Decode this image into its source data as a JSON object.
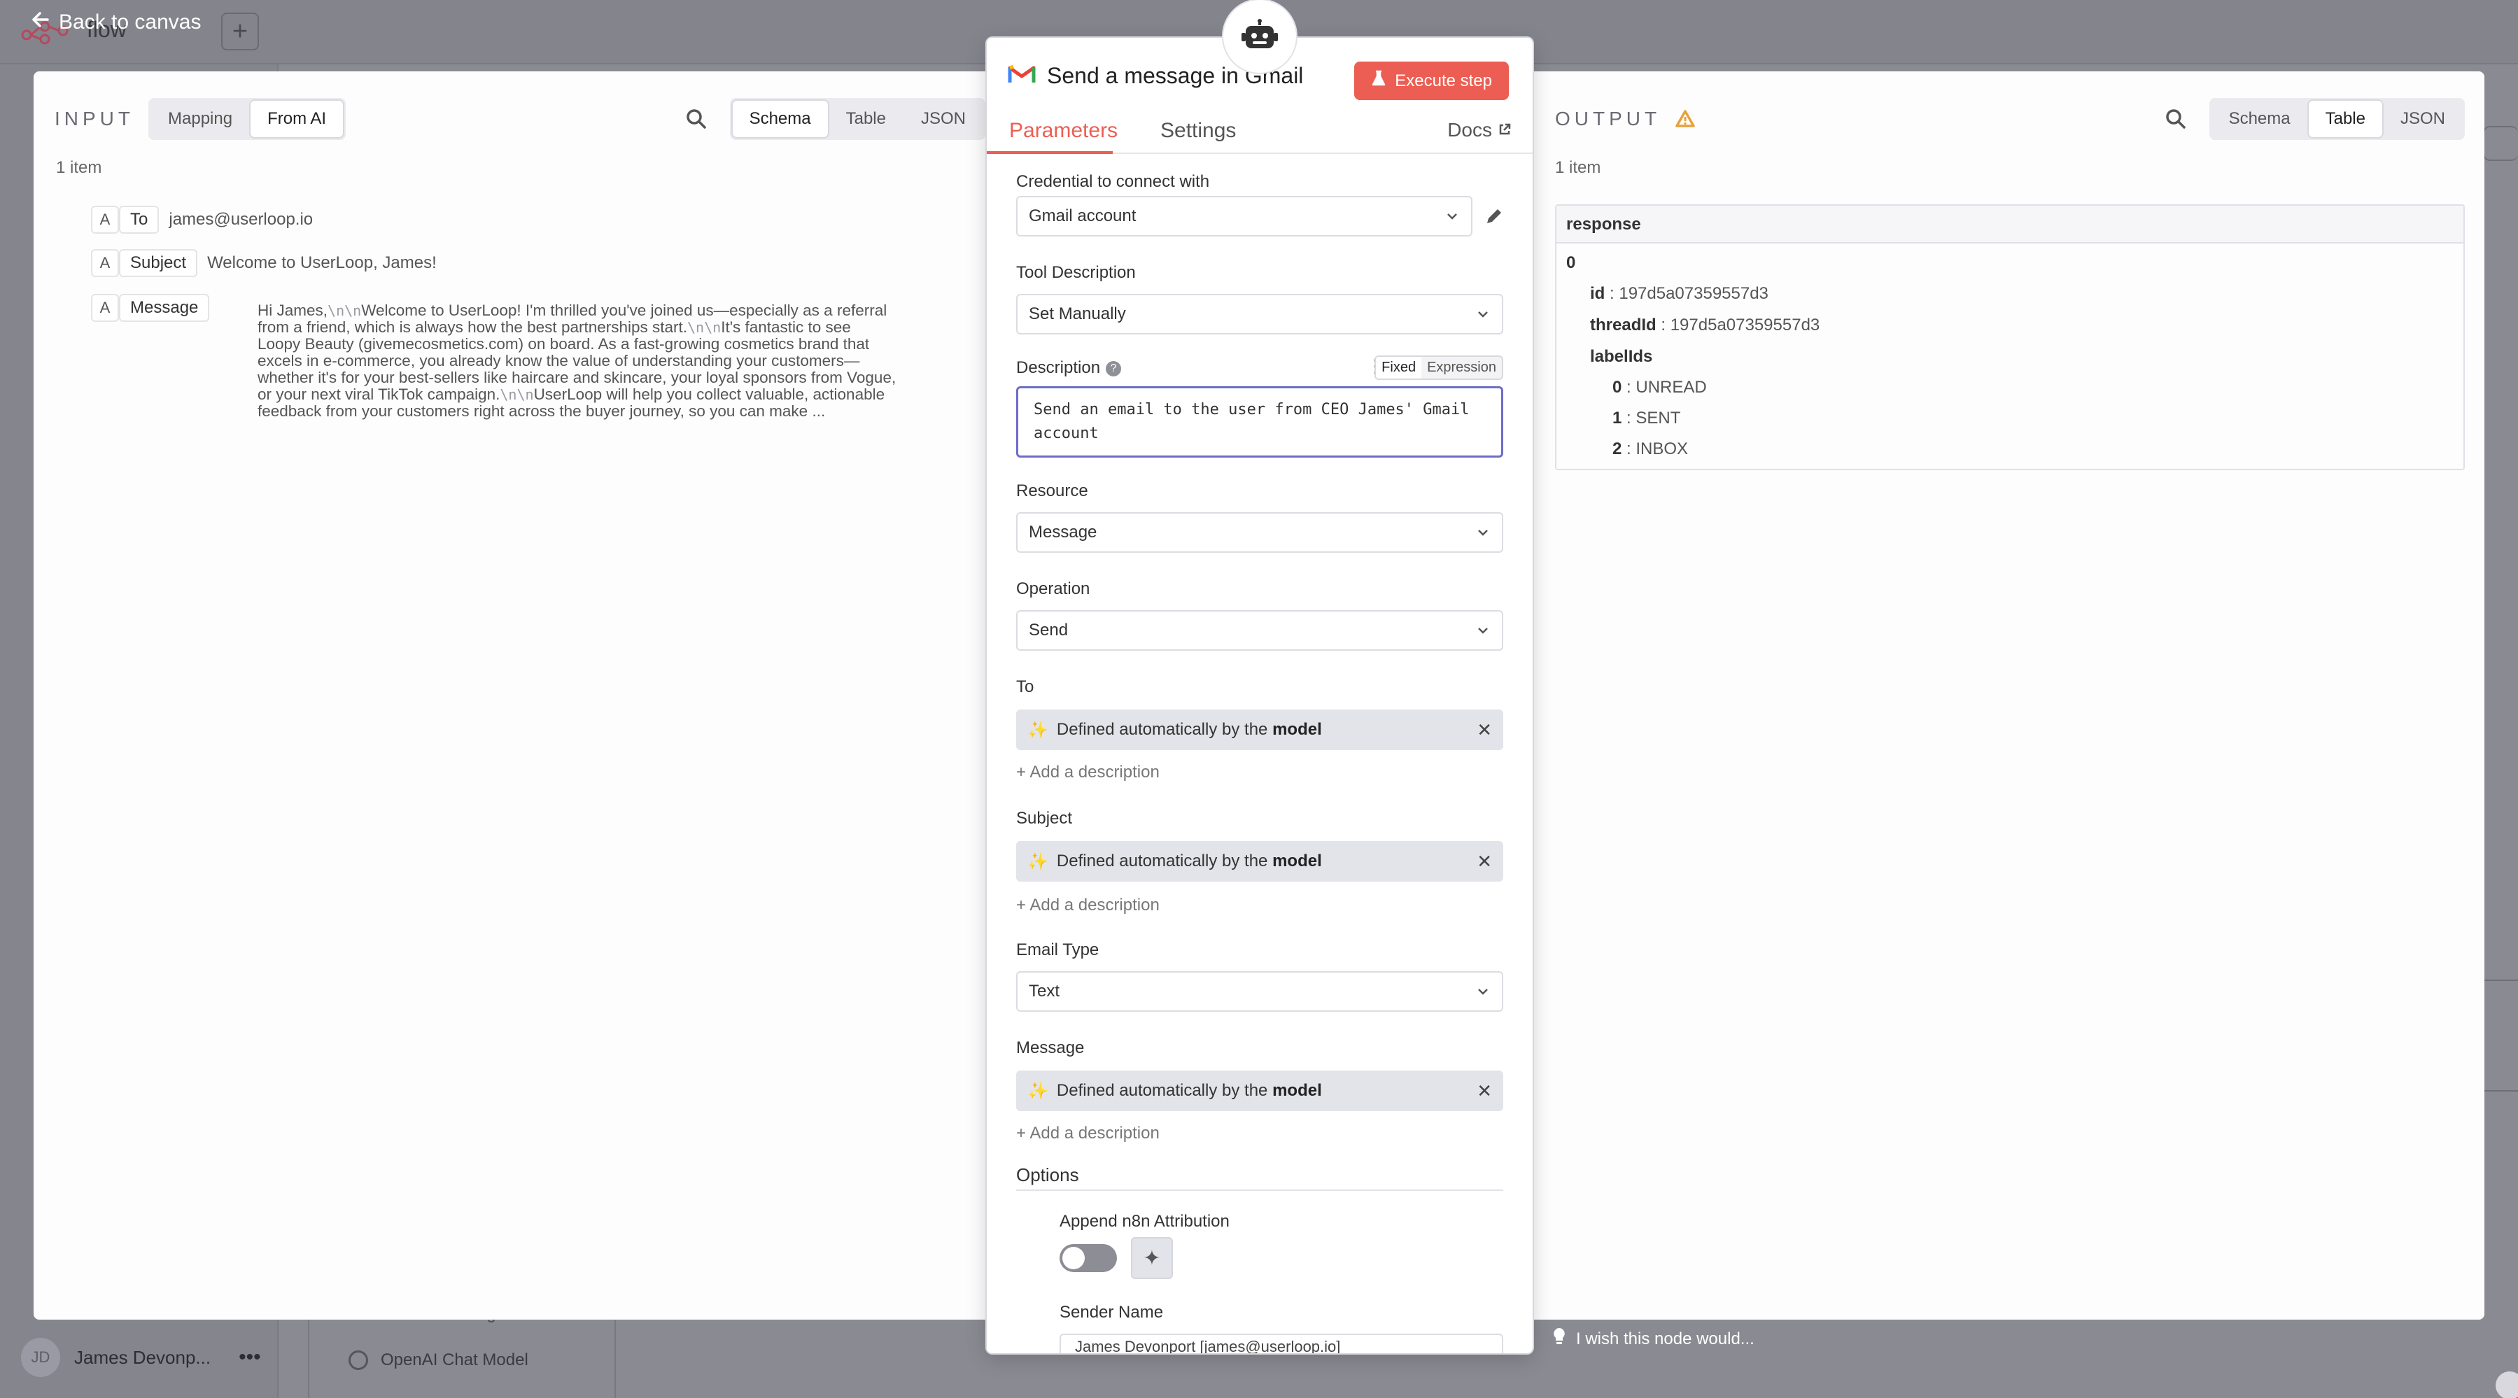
{
  "background": {
    "workflow_name": "flow",
    "back_label": "Back to canvas",
    "user_initials": "JD",
    "user_name": "James Devonp...",
    "bg_node_1": "Send a message in Gmail",
    "bg_node_2": "OpenAI Chat Model",
    "wish_text": "I wish this node would..."
  },
  "input_panel": {
    "title": "INPUT",
    "mode_options": [
      "Mapping",
      "From AI"
    ],
    "mode_selected": "From AI",
    "view_options": [
      "Schema",
      "Table",
      "JSON"
    ],
    "view_selected": "Schema",
    "item_count": "1 item",
    "fields": [
      {
        "type": "A",
        "key": "To",
        "value": "james@userloop.io"
      },
      {
        "type": "A",
        "key": "Subject",
        "value": "Welcome to UserLoop, James!"
      },
      {
        "type": "A",
        "key": "Message",
        "value": ""
      }
    ],
    "message_lines": [
      [
        "Hi James,",
        "\\n\\n",
        "Welcome to UserLoop! I'm thrilled you've joined us—especially as a referral"
      ],
      [
        "from a friend, which is always how the best partnerships start.",
        "\\n\\n",
        "It's fantastic to see"
      ],
      [
        "Loopy Beauty (givemecosmetics.com) on board. As a fast-growing cosmetics brand that",
        "",
        ""
      ],
      [
        "excels in e-commerce, you already know the value of understanding your customers—",
        "",
        ""
      ],
      [
        "whether it's for your best-sellers like haircare and skincare, your loyal sponsors from Vogue,",
        "",
        ""
      ],
      [
        "or your next viral TikTok campaign.",
        "\\n\\n",
        "UserLoop will help you collect valuable, actionable"
      ],
      [
        "feedback from your customers right across the buyer journey, so you can make ...",
        "",
        ""
      ]
    ]
  },
  "node_panel": {
    "title": "Send a message in Gmail",
    "execute_label": "Execute step",
    "tabs": [
      "Parameters",
      "Settings"
    ],
    "active_tab": "Parameters",
    "docs_label": "Docs",
    "credential_label": "Credential to connect with",
    "credential_value": "Gmail account",
    "tool_desc_label": "Tool Description",
    "tool_desc_value": "Set Manually",
    "description_label": "Description",
    "description_toggle": [
      "Fixed",
      "Expression"
    ],
    "description_value": "Send an email to the user from CEO James' Gmail account",
    "resource_label": "Resource",
    "resource_value": "Message",
    "operation_label": "Operation",
    "operation_value": "Send",
    "to_label": "To",
    "subject_label": "Subject",
    "email_type_label": "Email Type",
    "email_type_value": "Text",
    "message_label": "Message",
    "ai_field_prefix": "Defined automatically by the",
    "ai_field_bold": "model",
    "add_description": "+ Add a description",
    "options_label": "Options",
    "append_label": "Append n8n Attribution",
    "sender_label": "Sender Name",
    "sender_value": "James Devonport [james@userloop.io]"
  },
  "output_panel": {
    "title": "OUTPUT",
    "view_options": [
      "Schema",
      "Table",
      "JSON"
    ],
    "view_selected": "Table",
    "item_count": "1 item",
    "header": "response",
    "index": "0",
    "id_key": "id",
    "id_value": "197d5a07359557d3",
    "thread_key": "threadId",
    "thread_value": "197d5a07359557d3",
    "labels_key": "labelIds",
    "labels": [
      {
        "i": "0",
        "v": "UNREAD"
      },
      {
        "i": "1",
        "v": "SENT"
      },
      {
        "i": "2",
        "v": "INBOX"
      }
    ]
  },
  "colors": {
    "accent": "#ec5e53",
    "focus_border": "#6d6dc8",
    "warning": "#e8a23b"
  }
}
